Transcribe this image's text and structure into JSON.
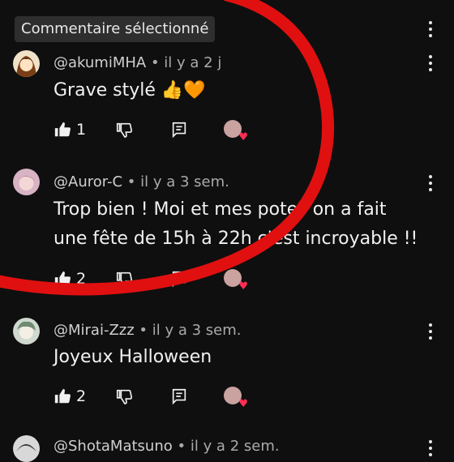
{
  "header": {
    "chip_label": "Commentaire sélectionné"
  },
  "comments": [
    {
      "author": "@akumiMHA",
      "time": "• il y a 2 j",
      "lines": [
        "Grave stylé 👍🧡"
      ],
      "likes": "1",
      "avatar_color": "#d9a24a"
    },
    {
      "author": "@Auror-C",
      "time": "• il y a 3 sem.",
      "lines": [
        "Trop bien ! Moi et mes potes on a fait",
        "une fête de 15h à 22h c'est incroyable !!"
      ],
      "likes": "2",
      "avatar_color": "#c98fa5"
    },
    {
      "author": "@Mirai-Zzz",
      "time": "• il y a 3 sem.",
      "lines": [
        "Joyeux Halloween"
      ],
      "likes": "2",
      "avatar_color": "#9bb7a2"
    },
    {
      "author": "@ShotaMatsuno",
      "time": "• il y a 2 sem.",
      "lines": [],
      "likes": "",
      "avatar_color": "#b8b8b8"
    }
  ],
  "icons": {
    "like": "thumbs-up-icon",
    "dislike": "thumbs-down-icon",
    "reply": "reply-icon",
    "menu": "more-vertical-icon",
    "creator_heart": "creator-heart-icon"
  },
  "colors": {
    "annotation_circle": "#e01010",
    "heart": "#ff2d55"
  }
}
